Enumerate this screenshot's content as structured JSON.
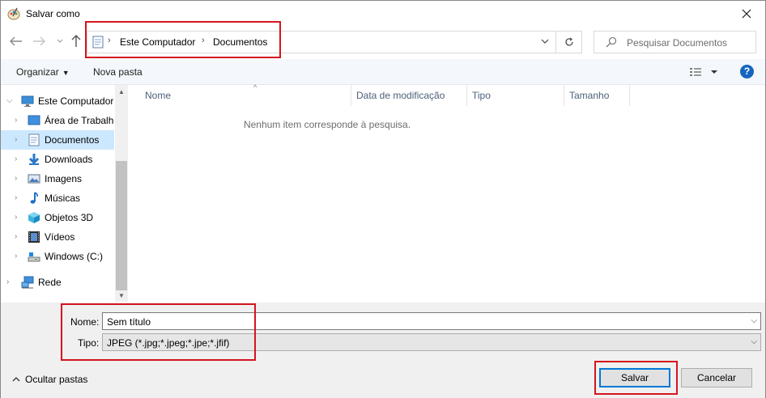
{
  "window": {
    "title": "Salvar como"
  },
  "address": {
    "crumbs": [
      "Este Computador",
      "Documentos"
    ]
  },
  "search": {
    "placeholder": "Pesquisar Documentos"
  },
  "toolbar": {
    "organize_label": "Organizar",
    "new_folder_label": "Nova pasta",
    "help_label": "?"
  },
  "sidebar": {
    "items": [
      {
        "label": "Este Computador",
        "icon": "computer-icon",
        "level": 0,
        "expanded": true
      },
      {
        "label": "Área de Trabalho",
        "icon": "desktop-icon",
        "level": 1
      },
      {
        "label": "Documentos",
        "icon": "documents-icon",
        "level": 1,
        "selected": true
      },
      {
        "label": "Downloads",
        "icon": "downloads-icon",
        "level": 1
      },
      {
        "label": "Imagens",
        "icon": "pictures-icon",
        "level": 1
      },
      {
        "label": "Músicas",
        "icon": "music-icon",
        "level": 1
      },
      {
        "label": "Objetos 3D",
        "icon": "3d-objects-icon",
        "level": 1
      },
      {
        "label": "Vídeos",
        "icon": "videos-icon",
        "level": 1
      },
      {
        "label": "Windows (C:)",
        "icon": "drive-icon",
        "level": 1
      },
      {
        "label": "Rede",
        "icon": "network-icon",
        "level": 0
      }
    ]
  },
  "columns": [
    "Nome",
    "Data de modificação",
    "Tipo",
    "Tamanho"
  ],
  "empty_message": "Nenhum item corresponde à pesquisa.",
  "form": {
    "name_label": "Nome:",
    "name_value": "Sem título",
    "type_label": "Tipo:",
    "type_value": "JPEG (*.jpg;*.jpeg;*.jpe;*.jfif)"
  },
  "footer": {
    "hide_folders_label": "Ocultar pastas",
    "save_label": "Salvar",
    "cancel_label": "Cancelar"
  },
  "colors": {
    "highlight": "#d5141e",
    "selection": "#cce8ff",
    "accent": "#0078d7"
  }
}
